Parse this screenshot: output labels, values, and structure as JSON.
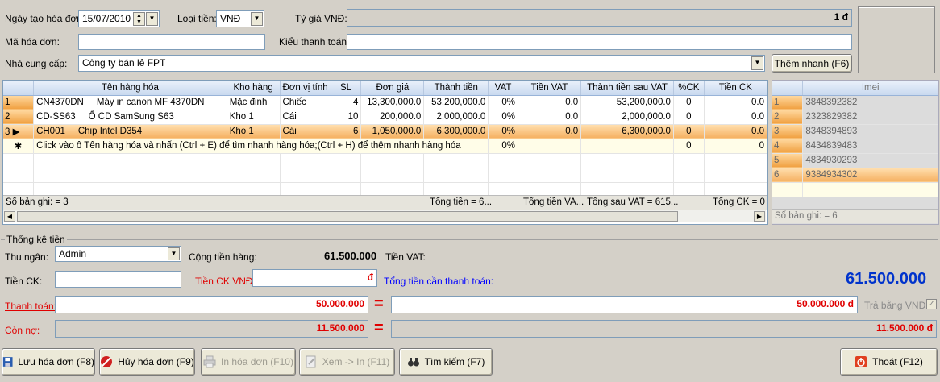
{
  "header": {
    "invoice_date_label": "Ngày tạo hóa đơn:",
    "invoice_date_value": "15/07/2010",
    "currency_label": "Loại tiền:",
    "currency_value": "VNĐ",
    "exchange_rate_label": "Tỷ giá VNĐ:",
    "exchange_rate_value": "1 đ",
    "invoice_code_label": "Mã hóa đơn:",
    "invoice_code_value": "",
    "payment_type_label": "Kiểu thanh toán:",
    "payment_type_value": "",
    "supplier_label": "Nhà cung cấp:",
    "supplier_value": "Công ty bán lẻ FPT",
    "quick_add_label": "Thêm nhanh (F6)"
  },
  "items_grid": {
    "columns": [
      "Tên hàng hóa",
      "Kho hàng",
      "Đơn vị tính",
      "SL",
      "Đơn giá",
      "Thành tiền",
      "VAT",
      "Tiền VAT",
      "Thành tiền sau VAT",
      "%CK",
      "Tiền CK"
    ],
    "rows": [
      {
        "no": "1",
        "code": "CN4370DN",
        "name": "Máy in canon MF 4370DN",
        "warehouse": "Mặc định",
        "unit": "Chiếc",
        "qty": "4",
        "price": "13,300,000.0",
        "amount": "53,200,000.0",
        "vat": "0%",
        "vat_amount": "0.0",
        "after_vat": "53,200,000.0",
        "ck_pct": "0",
        "ck_amount": "0.0"
      },
      {
        "no": "2",
        "code": "CD-SS63",
        "name": "Ổ CD SamSung S63",
        "warehouse": "Kho 1",
        "unit": "Cái",
        "qty": "10",
        "price": "200,000.0",
        "amount": "2,000,000.0",
        "vat": "0%",
        "vat_amount": "0.0",
        "after_vat": "2,000,000.0",
        "ck_pct": "0",
        "ck_amount": "0.0"
      },
      {
        "no": "3",
        "code": "CH001",
        "name": "Chip Intel D354",
        "warehouse": "Kho 1",
        "unit": "Cái",
        "qty": "6",
        "price": "1,050,000.0",
        "amount": "6,300,000.0",
        "vat": "0%",
        "vat_amount": "0.0",
        "after_vat": "6,300,000.0",
        "ck_pct": "0",
        "ck_amount": "0.0"
      }
    ],
    "new_row_hint": "Click vào ô Tên hàng hóa và nhấn (Ctrl + E) để tìm nhanh hàng hóa;(Ctrl + H) để thêm nhanh hàng hóa",
    "new_row_vat": "0%",
    "new_row_ck_pct": "0",
    "new_row_ck_amount": "0",
    "footer_count": "Số bản ghi: = 3",
    "footer_total": "Tổng tiền = 6...",
    "footer_vat": "Tổng tiền VA...",
    "footer_after_vat": "Tổng sau VAT = 615...",
    "footer_ck": "Tổng CK = 0"
  },
  "imei_grid": {
    "header": "Imei",
    "rows": [
      {
        "no": "1",
        "imei": "3848392382"
      },
      {
        "no": "2",
        "imei": "2323829382"
      },
      {
        "no": "3",
        "imei": "8348394893"
      },
      {
        "no": "4",
        "imei": "8434839483"
      },
      {
        "no": "5",
        "imei": "4834930293"
      },
      {
        "no": "6",
        "imei": "9384934302"
      }
    ],
    "footer_count": "Số bản ghi: = 6"
  },
  "summary": {
    "group_title": "Thống kê tiền",
    "cashier_label": "Thu ngân:",
    "cashier_value": "Admin",
    "goods_total_label": "Cộng tiền hàng:",
    "goods_total_value": "61.500.000",
    "vat_label": "Tiền VAT:",
    "ck_label": "Tiền CK:",
    "ck_value": "",
    "ck_vnd_label": "Tiền CK VNĐ:",
    "ck_vnd_value": "đ",
    "total_due_label": "Tổng tiền cần thanh toán:",
    "total_due_value": "61.500.000",
    "payment_label": "Thanh toán:",
    "payment_value": "50.000.000",
    "payment_vnd_value": "50.000.000 đ",
    "pay_in_vnd_label": "Trả bằng VNĐ",
    "pay_in_vnd_checked": "✓",
    "debt_label": "Còn nợ:",
    "debt_value": "11.500.000",
    "debt_vnd_value": "11.500.000 đ",
    "equals_sign": "="
  },
  "toolbar": {
    "save_label": "Lưu hóa đơn (F8)",
    "cancel_label": "Hủy hóa đơn (F9)",
    "print_label": "In hóa đơn (F10)",
    "preview_label": "Xem -> In (F11)",
    "search_label": "Tìm kiếm (F7)",
    "exit_label": "Thoát (F12)"
  },
  "colors": {
    "label_red": "#e00000",
    "label_blue": "#0000ff",
    "total_blue": "#0033cc",
    "row_orange": "#f5b060"
  }
}
